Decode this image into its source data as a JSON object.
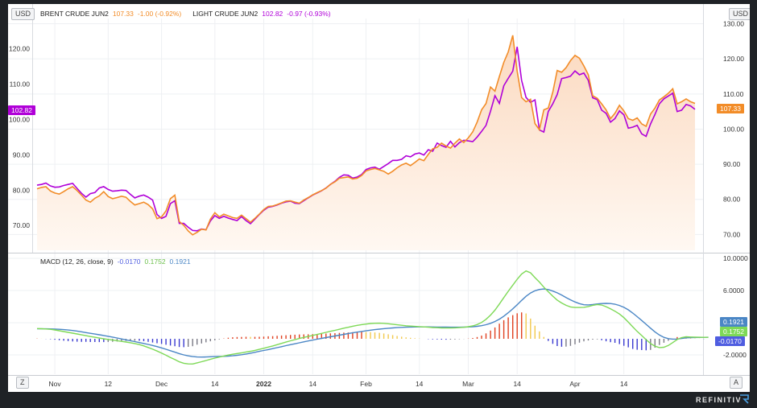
{
  "currency_label": "USD",
  "bottom_left_chip": "Z",
  "bottom_right_chip": "A",
  "brand": "REFINITIV",
  "legend_top": [
    {
      "name": "BRENT CRUDE JUN2",
      "value": "107.33",
      "change": "-1.00 (-0.92%)",
      "color": "#f28c28"
    },
    {
      "name": "LIGHT CRUDE JUN2",
      "value": "102.82",
      "change": "-0.97 (-0.93%)",
      "color": "#b000d8"
    }
  ],
  "macd_legend": {
    "label": "MACD (12, 26, close, 9)",
    "values": [
      "-0.0170",
      "0.1752",
      "0.1921"
    ],
    "colors": [
      "#4f5de0",
      "#7ed957",
      "#4a86c5"
    ]
  },
  "colors": {
    "brent": "#f28c28",
    "light": "#b000d8",
    "signal": "#4a86c5",
    "macd": "#7ed957",
    "hist_pos": "#e04020",
    "hist_neg": "#3b3bd0",
    "fill_top": "#fbd9bf",
    "fill_bottom": "#fff8f2"
  },
  "chart_data": [
    {
      "type": "line",
      "title": "",
      "left_axis": {
        "ticks": [
          70,
          80,
          90,
          100,
          110,
          120
        ],
        "labels": [
          "70.00",
          "80.00",
          "90.00",
          "100.00",
          "110.00",
          "120.00"
        ],
        "ylim": [
          63,
          128.5
        ],
        "series": "LIGHT CRUDE JUN2"
      },
      "right_axis": {
        "ticks": [
          70,
          80,
          90,
          100,
          110,
          120,
          130
        ],
        "labels": [
          "70.00",
          "80.00",
          "90.00",
          "100.00",
          "110.00",
          "120.00",
          "130.00"
        ],
        "ylim": [
          65.5,
          131.5
        ],
        "series": "BRENT CRUDE JUN2"
      },
      "x_tick_labels": [
        "Nov",
        "12",
        "Dec",
        "14",
        "2022",
        "14",
        "Feb",
        "14",
        "Mar",
        "14",
        "Apr",
        "14"
      ],
      "x_tick_index": [
        4,
        16,
        28,
        40,
        51,
        62,
        74,
        86,
        97,
        108,
        121,
        132
      ],
      "series": [
        {
          "name": "BRENT CRUDE JUN2",
          "axis": "right",
          "last_value": 107.33,
          "values": [
            83.0,
            83.4,
            83.6,
            82.4,
            81.8,
            81.5,
            82.2,
            83.0,
            83.6,
            82.5,
            81.2,
            79.8,
            79.2,
            80.3,
            81.0,
            82.2,
            80.8,
            80.2,
            80.5,
            80.9,
            80.6,
            79.4,
            78.4,
            78.8,
            79.2,
            78.5,
            77.3,
            74.5,
            75.0,
            76.7,
            80.2,
            81.2,
            73.7,
            72.6,
            71.0,
            69.9,
            70.6,
            71.5,
            71.3,
            74.4,
            76.2,
            75.0,
            75.8,
            75.3,
            74.8,
            74.6,
            75.5,
            74.5,
            73.5,
            74.6,
            75.8,
            77.1,
            78.0,
            78.1,
            78.5,
            79.0,
            79.5,
            79.6,
            79.2,
            78.9,
            79.8,
            80.5,
            81.3,
            81.9,
            82.5,
            83.2,
            84.3,
            85.0,
            86.0,
            86.2,
            86.4,
            85.8,
            86.0,
            86.8,
            88.1,
            88.5,
            88.8,
            88.4,
            88.0,
            87.2,
            88.0,
            89.0,
            89.8,
            90.3,
            89.6,
            90.5,
            91.5,
            91.0,
            92.8,
            94.4,
            94.8,
            96.0,
            95.2,
            94.6,
            96.0,
            97.2,
            96.2,
            97.5,
            99.2,
            102.0,
            105.5,
            107.3,
            112.0,
            110.8,
            115.0,
            119.0,
            122.0,
            126.7,
            116.5,
            109.0,
            107.8,
            108.5,
            101.6,
            99.8,
            105.5,
            106.0,
            110.5,
            116.7,
            116.2,
            117.5,
            119.5,
            121.0,
            120.2,
            118.0,
            115.5,
            109.5,
            108.8,
            107.2,
            105.5,
            103.0,
            104.5,
            106.8,
            105.2,
            103.0,
            102.5,
            103.2,
            101.5,
            100.8,
            104.3,
            106.0,
            108.3,
            109.2,
            110.2,
            111.5,
            107.2,
            107.8,
            108.6,
            107.8,
            107.33
          ]
        },
        {
          "name": "LIGHT CRUDE JUN2",
          "axis": "left",
          "last_value": 102.82,
          "values": [
            81.4,
            81.6,
            82.0,
            81.2,
            80.8,
            80.9,
            81.3,
            81.6,
            81.9,
            80.5,
            79.1,
            78.0,
            79.0,
            79.3,
            80.6,
            81.0,
            80.2,
            79.7,
            79.8,
            80.0,
            79.9,
            78.8,
            77.8,
            78.3,
            78.6,
            78.0,
            77.2,
            73.1,
            72.0,
            72.6,
            76.2,
            77.0,
            70.6,
            70.6,
            69.5,
            68.6,
            68.5,
            69.0,
            68.8,
            71.3,
            72.8,
            72.0,
            72.6,
            72.1,
            71.7,
            71.4,
            72.5,
            71.4,
            70.5,
            71.8,
            73.1,
            74.3,
            75.2,
            75.4,
            75.8,
            76.3,
            76.7,
            76.9,
            76.3,
            76.2,
            77.0,
            77.8,
            78.6,
            79.2,
            79.8,
            80.6,
            81.6,
            82.5,
            83.6,
            84.3,
            84.2,
            83.4,
            83.7,
            84.4,
            85.8,
            86.3,
            86.5,
            85.9,
            86.7,
            87.5,
            88.4,
            88.4,
            88.7,
            89.7,
            89.4,
            90.2,
            90.5,
            89.9,
            91.4,
            91.0,
            93.3,
            92.6,
            92.1,
            93.8,
            92.2,
            93.4,
            94.1,
            93.9,
            93.7,
            95.0,
            96.6,
            98.3,
            102.3,
            106.7,
            104.5,
            109.5,
            111.6,
            113.6,
            120.5,
            111.0,
            106.2,
            104.8,
            105.5,
            97.0,
            96.4,
            102.2,
            104.4,
            107.0,
            111.5,
            111.8,
            112.2,
            113.7,
            112.6,
            113.1,
            111.0,
            106.1,
            105.6,
            102.6,
            101.7,
            99.2,
            100.2,
            102.4,
            101.3,
            97.5,
            97.8,
            98.3,
            95.9,
            95.2,
            98.7,
            101.4,
            104.4,
            105.8,
            106.6,
            107.4,
            102.2,
            102.6,
            104.2,
            103.8,
            102.82
          ]
        }
      ]
    },
    {
      "type": "line",
      "title": "MACD (12, 26, close, 9)",
      "y_axis": {
        "ticks": [
          -2,
          2,
          6,
          10
        ],
        "labels": [
          "-2.0000",
          "",
          "6.0000",
          "10.0000"
        ],
        "ylim": [
          -4.4,
          10.4
        ]
      },
      "series": [
        {
          "name": "MACD",
          "last_value": 0.1752,
          "values": [
            1.27,
            1.25,
            1.22,
            1.18,
            1.1,
            1.0,
            0.9,
            0.8,
            0.7,
            0.6,
            0.49,
            0.39,
            0.28,
            0.19,
            0.09,
            0.0,
            -0.08,
            -0.16,
            -0.24,
            -0.32,
            -0.4,
            -0.49,
            -0.59,
            -0.72,
            -0.88,
            -1.08,
            -1.29,
            -1.52,
            -1.77,
            -2.04,
            -2.32,
            -2.58,
            -2.86,
            -3.04,
            -3.12,
            -3.13,
            -2.99,
            -2.85,
            -2.7,
            -2.54,
            -2.4,
            -2.27,
            -2.14,
            -2.02,
            -1.92,
            -1.83,
            -1.75,
            -1.64,
            -1.55,
            -1.44,
            -1.31,
            -1.18,
            -1.03,
            -0.89,
            -0.73,
            -0.57,
            -0.41,
            -0.25,
            -0.11,
            0.04,
            0.17,
            0.29,
            0.42,
            0.54,
            0.67,
            0.8,
            0.93,
            1.05,
            1.18,
            1.32,
            1.43,
            1.56,
            1.67,
            1.76,
            1.83,
            1.9,
            1.93,
            1.94,
            1.92,
            1.87,
            1.81,
            1.74,
            1.68,
            1.62,
            1.58,
            1.54,
            1.51,
            1.48,
            1.44,
            1.4,
            1.38,
            1.35,
            1.34,
            1.34,
            1.36,
            1.39,
            1.43,
            1.5,
            1.6,
            1.77,
            2.03,
            2.42,
            2.94,
            3.56,
            4.32,
            5.12,
            5.9,
            6.66,
            7.4,
            8.05,
            8.43,
            8.2,
            7.6,
            7.05,
            6.42,
            5.85,
            5.3,
            4.81,
            4.45,
            4.16,
            3.96,
            3.89,
            3.89,
            3.91,
            4.0,
            4.16,
            4.26,
            4.2,
            3.99,
            3.72,
            3.43,
            3.08,
            2.63,
            2.07,
            1.49,
            0.92,
            0.41,
            -0.11,
            -0.58,
            -0.92,
            -1.09,
            -1.05,
            -0.83,
            -0.47,
            -0.09,
            0.15,
            0.25,
            0.22,
            0.2,
            0.19,
            0.18,
            0.18
          ]
        },
        {
          "name": "Signal",
          "last_value": 0.1921,
          "values": [
            1.24,
            1.24,
            1.24,
            1.23,
            1.21,
            1.18,
            1.14,
            1.09,
            1.03,
            0.96,
            0.87,
            0.77,
            0.68,
            0.59,
            0.5,
            0.41,
            0.31,
            0.21,
            0.1,
            -0.02,
            -0.13,
            -0.24,
            -0.35,
            -0.47,
            -0.58,
            -0.7,
            -0.83,
            -0.97,
            -1.13,
            -1.3,
            -1.48,
            -1.66,
            -1.84,
            -2.0,
            -2.12,
            -2.21,
            -2.26,
            -2.27,
            -2.26,
            -2.23,
            -2.21,
            -2.2,
            -2.18,
            -2.15,
            -2.11,
            -2.05,
            -1.98,
            -1.89,
            -1.79,
            -1.68,
            -1.56,
            -1.45,
            -1.34,
            -1.22,
            -1.1,
            -0.98,
            -0.85,
            -0.73,
            -0.62,
            -0.5,
            -0.38,
            -0.27,
            -0.16,
            -0.05,
            0.05,
            0.15,
            0.25,
            0.35,
            0.45,
            0.55,
            0.65,
            0.74,
            0.83,
            0.91,
            0.99,
            1.07,
            1.14,
            1.2,
            1.26,
            1.31,
            1.35,
            1.39,
            1.42,
            1.44,
            1.46,
            1.47,
            1.48,
            1.48,
            1.48,
            1.47,
            1.46,
            1.45,
            1.45,
            1.44,
            1.44,
            1.44,
            1.45,
            1.47,
            1.5,
            1.55,
            1.63,
            1.75,
            1.92,
            2.15,
            2.44,
            2.81,
            3.24,
            3.72,
            4.23,
            4.77,
            5.28,
            5.69,
            5.97,
            6.13,
            6.19,
            6.12,
            5.93,
            5.71,
            5.44,
            5.13,
            4.84,
            4.58,
            4.37,
            4.23,
            4.21,
            4.26,
            4.33,
            4.38,
            4.4,
            4.38,
            4.3,
            4.14,
            3.91,
            3.6,
            3.2,
            2.75,
            2.28,
            1.8,
            1.32,
            0.86,
            0.47,
            0.18,
            0.02,
            -0.04,
            -0.03,
            0.04,
            0.12,
            0.15,
            0.16,
            0.17,
            0.18,
            0.19
          ]
        },
        {
          "name": "Histogram",
          "last_value": -0.017,
          "values": [
            0.03,
            0.01,
            -0.02,
            -0.05,
            -0.11,
            -0.18,
            -0.24,
            -0.29,
            -0.33,
            -0.36,
            -0.38,
            -0.38,
            -0.4,
            -0.4,
            -0.41,
            -0.41,
            -0.39,
            -0.37,
            -0.34,
            -0.3,
            -0.27,
            -0.25,
            -0.24,
            -0.25,
            -0.3,
            -0.38,
            -0.46,
            -0.55,
            -0.64,
            -0.74,
            -0.84,
            -0.92,
            -1.02,
            -1.04,
            -1.0,
            -0.92,
            -0.73,
            -0.58,
            -0.44,
            -0.31,
            -0.19,
            -0.07,
            0.04,
            0.13,
            0.19,
            0.22,
            0.23,
            0.25,
            0.24,
            0.24,
            0.25,
            0.27,
            0.31,
            0.33,
            0.37,
            0.41,
            0.44,
            0.48,
            0.51,
            0.54,
            0.55,
            0.56,
            0.58,
            0.59,
            0.62,
            0.65,
            0.68,
            0.7,
            0.73,
            0.77,
            0.78,
            0.82,
            0.84,
            0.85,
            0.84,
            0.83,
            0.79,
            0.74,
            0.66,
            0.56,
            0.46,
            0.35,
            0.26,
            0.18,
            0.12,
            0.07,
            0.03,
            0.0,
            -0.04,
            -0.07,
            -0.08,
            -0.1,
            -0.11,
            -0.1,
            -0.08,
            -0.05,
            -0.02,
            0.03,
            0.1,
            0.22,
            0.4,
            0.67,
            1.02,
            1.41,
            1.88,
            2.31,
            2.66,
            2.94,
            3.17,
            3.28,
            3.15,
            2.51,
            1.63,
            0.92,
            0.23,
            -0.27,
            -0.63,
            -0.9,
            -0.99,
            -0.97,
            -0.88,
            -0.69,
            -0.48,
            -0.32,
            -0.21,
            -0.1,
            -0.07,
            -0.18,
            -0.31,
            -0.42,
            -0.5,
            -0.66,
            -0.87,
            -1.06,
            -1.26,
            -1.36,
            -1.4,
            -1.43,
            -1.38,
            -1.1,
            -0.77,
            -0.49,
            -0.25,
            0.01,
            0.22,
            0.19,
            0.12,
            0.06,
            0.03,
            0.02,
            -0.02
          ]
        }
      ]
    }
  ]
}
